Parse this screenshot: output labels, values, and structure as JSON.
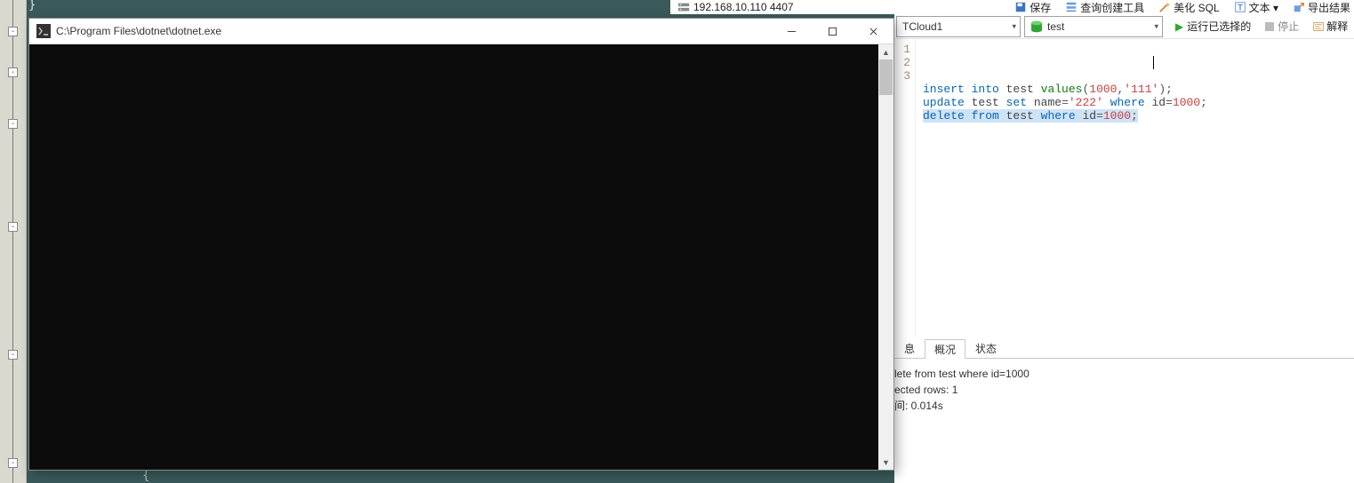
{
  "server": {
    "address": "192.168.10.110 4407"
  },
  "top_toolbar": {
    "save": "保存",
    "query_tool": "查询创建工具",
    "beautify": "美化 SQL",
    "text_menu": "文本 ▾",
    "export": "导出结果"
  },
  "conn_select": {
    "value": "TCloud1"
  },
  "db_select": {
    "value": "test"
  },
  "run_selected": "运行已选择的",
  "stop": "停止",
  "explain": "解释",
  "sql": {
    "line_numbers": [
      "1",
      "2",
      "3"
    ],
    "lines": [
      {
        "tokens": [
          {
            "t": "insert ",
            "c": "kw"
          },
          {
            "t": "into ",
            "c": "kw"
          },
          {
            "t": "test ",
            "c": "ident"
          },
          {
            "t": "values",
            "c": "func"
          },
          {
            "t": "(",
            "c": "punct"
          },
          {
            "t": "1000",
            "c": "num"
          },
          {
            "t": ",",
            "c": "punct"
          },
          {
            "t": "'111'",
            "c": "str"
          },
          {
            "t": ")",
            "c": "punct"
          },
          {
            "t": ";",
            "c": "punct"
          }
        ]
      },
      {
        "tokens": [
          {
            "t": "update ",
            "c": "kw"
          },
          {
            "t": "test ",
            "c": "ident"
          },
          {
            "t": "set ",
            "c": "kw"
          },
          {
            "t": "name",
            "c": "ident"
          },
          {
            "t": "=",
            "c": "punct"
          },
          {
            "t": "'222' ",
            "c": "str"
          },
          {
            "t": "where ",
            "c": "kw"
          },
          {
            "t": "id",
            "c": "ident"
          },
          {
            "t": "=",
            "c": "punct"
          },
          {
            "t": "1000",
            "c": "num"
          },
          {
            "t": ";",
            "c": "punct"
          }
        ]
      },
      {
        "selected": true,
        "tokens": [
          {
            "t": "delete ",
            "c": "kw"
          },
          {
            "t": "from ",
            "c": "kw"
          },
          {
            "t": "test ",
            "c": "ident"
          },
          {
            "t": "where ",
            "c": "kw"
          },
          {
            "t": "id",
            "c": "ident"
          },
          {
            "t": "=",
            "c": "punct"
          },
          {
            "t": "1000",
            "c": "num"
          },
          {
            "t": ";",
            "c": "punct"
          }
        ]
      }
    ]
  },
  "result_tabs": {
    "info": "息",
    "profile": "概况",
    "status": "状态"
  },
  "result": {
    "query": "lete from test where id=1000",
    "rows": "ected rows: 1",
    "time": "间: 0.014s"
  },
  "console": {
    "title": "C:\\Program Files\\dotnet\\dotnet.exe"
  },
  "bg_fold_positions": [
    30,
    76,
    134,
    250,
    394,
    516
  ],
  "bg_code1": "}",
  "bg_code2": "{"
}
